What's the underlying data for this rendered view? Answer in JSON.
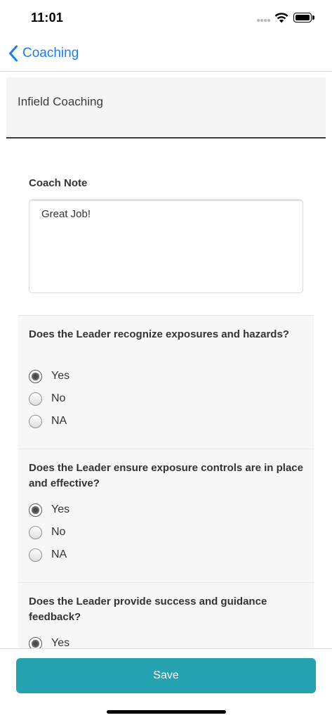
{
  "status_bar": {
    "time": "11:01",
    "icons": [
      "signal-dots-icon",
      "wifi-icon",
      "battery-icon"
    ]
  },
  "nav": {
    "back_label": "Coaching",
    "back_icon": "chevron-left-icon",
    "accent_color": "#1a7ef2"
  },
  "form": {
    "title": "Infield Coaching"
  },
  "coach_note": {
    "label": "Coach Note",
    "value": "Great Job!"
  },
  "questions": [
    {
      "text": "Does the Leader recognize exposures and hazards?",
      "options": [
        {
          "label": "Yes",
          "selected": true
        },
        {
          "label": "No",
          "selected": false
        },
        {
          "label": "NA",
          "selected": false
        }
      ]
    },
    {
      "text": "Does the Leader ensure exposure controls are in place and effective?",
      "options": [
        {
          "label": "Yes",
          "selected": true
        },
        {
          "label": "No",
          "selected": false
        },
        {
          "label": "NA",
          "selected": false
        }
      ]
    },
    {
      "text": "Does the Leader provide success and guidance feedback?",
      "options": [
        {
          "label": "Yes",
          "selected": true
        }
      ]
    }
  ],
  "footer": {
    "save_label": "Save",
    "save_color": "#26a3b0"
  }
}
